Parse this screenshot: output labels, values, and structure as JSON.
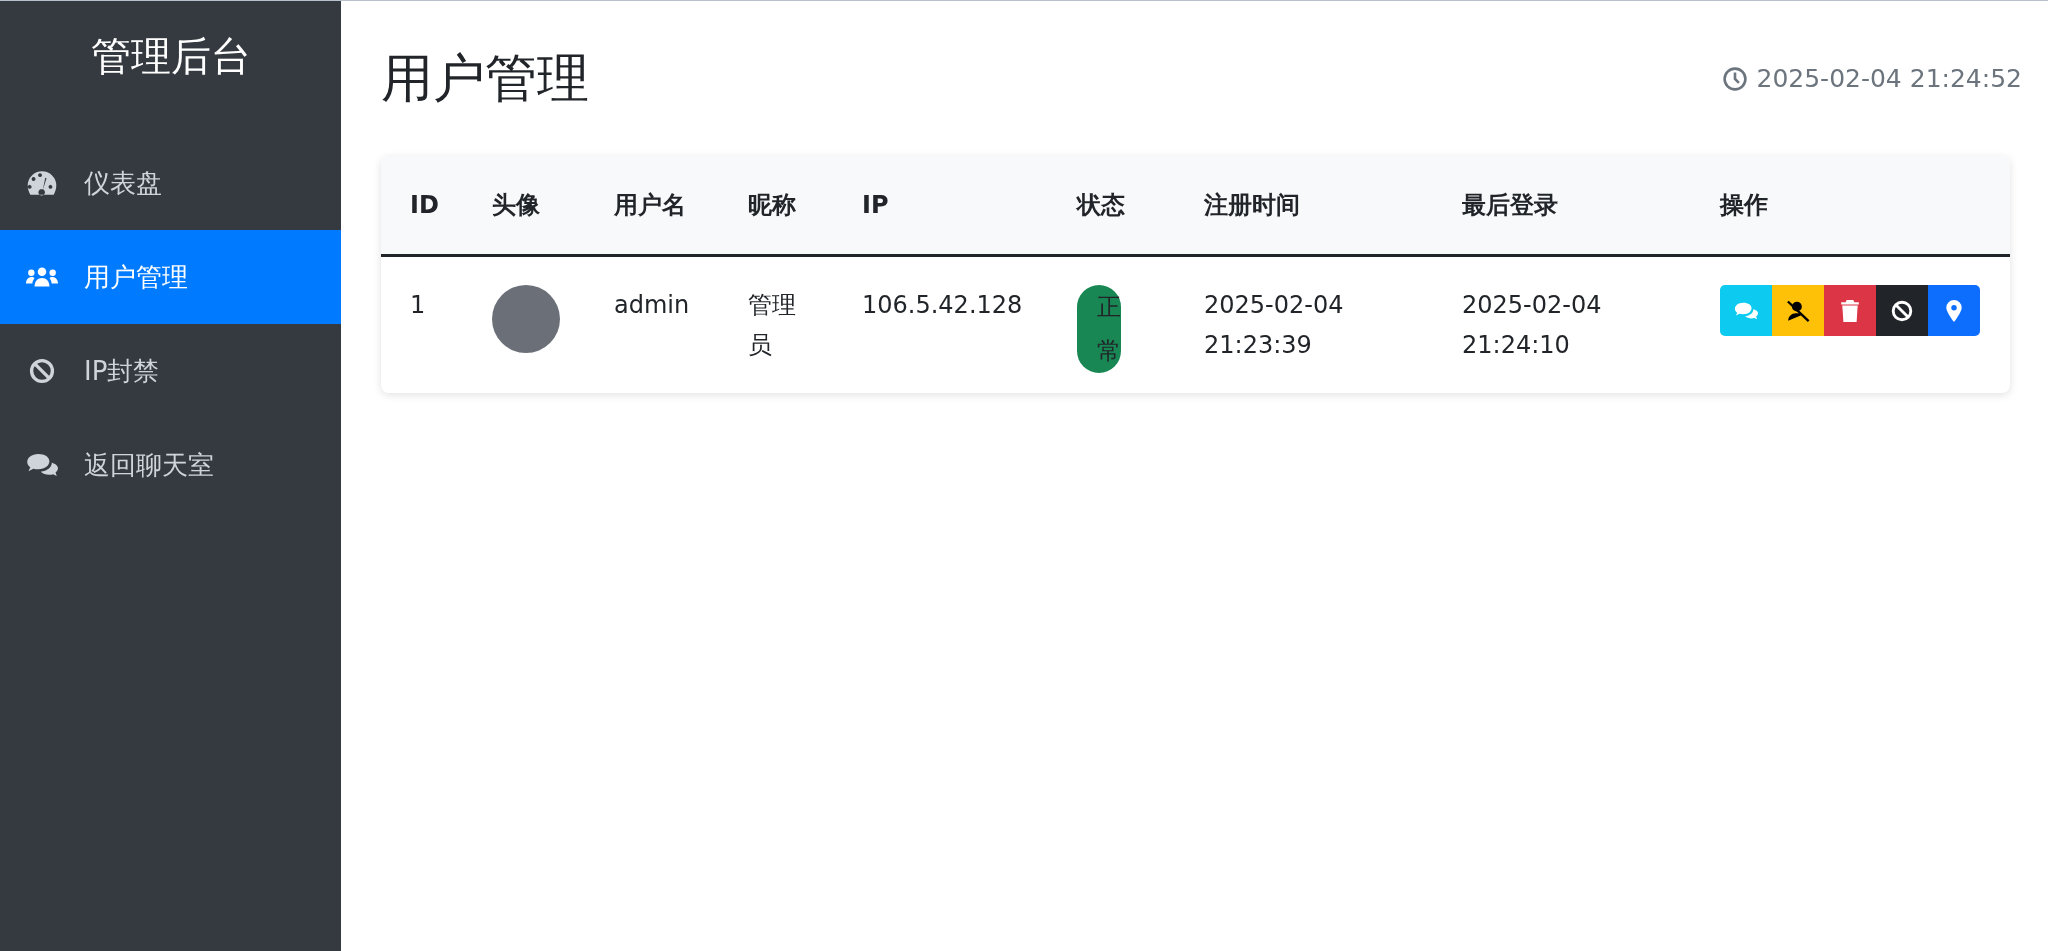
{
  "sidebar": {
    "title": "管理后台",
    "items": [
      {
        "kind": "gauge",
        "label": "仪表盘",
        "selected": false
      },
      {
        "kind": "users",
        "label": "用户管理",
        "selected": true
      },
      {
        "kind": "ban",
        "label": "IP封禁",
        "selected": false
      },
      {
        "kind": "comments",
        "label": "返回聊天室",
        "selected": false
      }
    ]
  },
  "page": {
    "title": "用户管理",
    "clock": "2025-02-04 21:24:52"
  },
  "table": {
    "columns": [
      "ID",
      "头像",
      "用户名",
      "昵称",
      "IP",
      "状态",
      "注册时间",
      "最后登录",
      "操作"
    ],
    "rows": [
      {
        "id": "1",
        "username": "admin",
        "nickname": "管理员",
        "ip": "106.5.42.128",
        "status": "正常",
        "registered": "2025-02-04 21:23:39",
        "last_login": "2025-02-04 21:24:10",
        "actions": [
          {
            "kind": "comments",
            "color": "#0dcaf0"
          },
          {
            "kind": "mute",
            "color": "#ffc107"
          },
          {
            "kind": "delete",
            "color": "#dc3545"
          },
          {
            "kind": "ban",
            "color": "#212529"
          },
          {
            "kind": "locate",
            "color": "#0d6efd"
          }
        ]
      }
    ]
  }
}
